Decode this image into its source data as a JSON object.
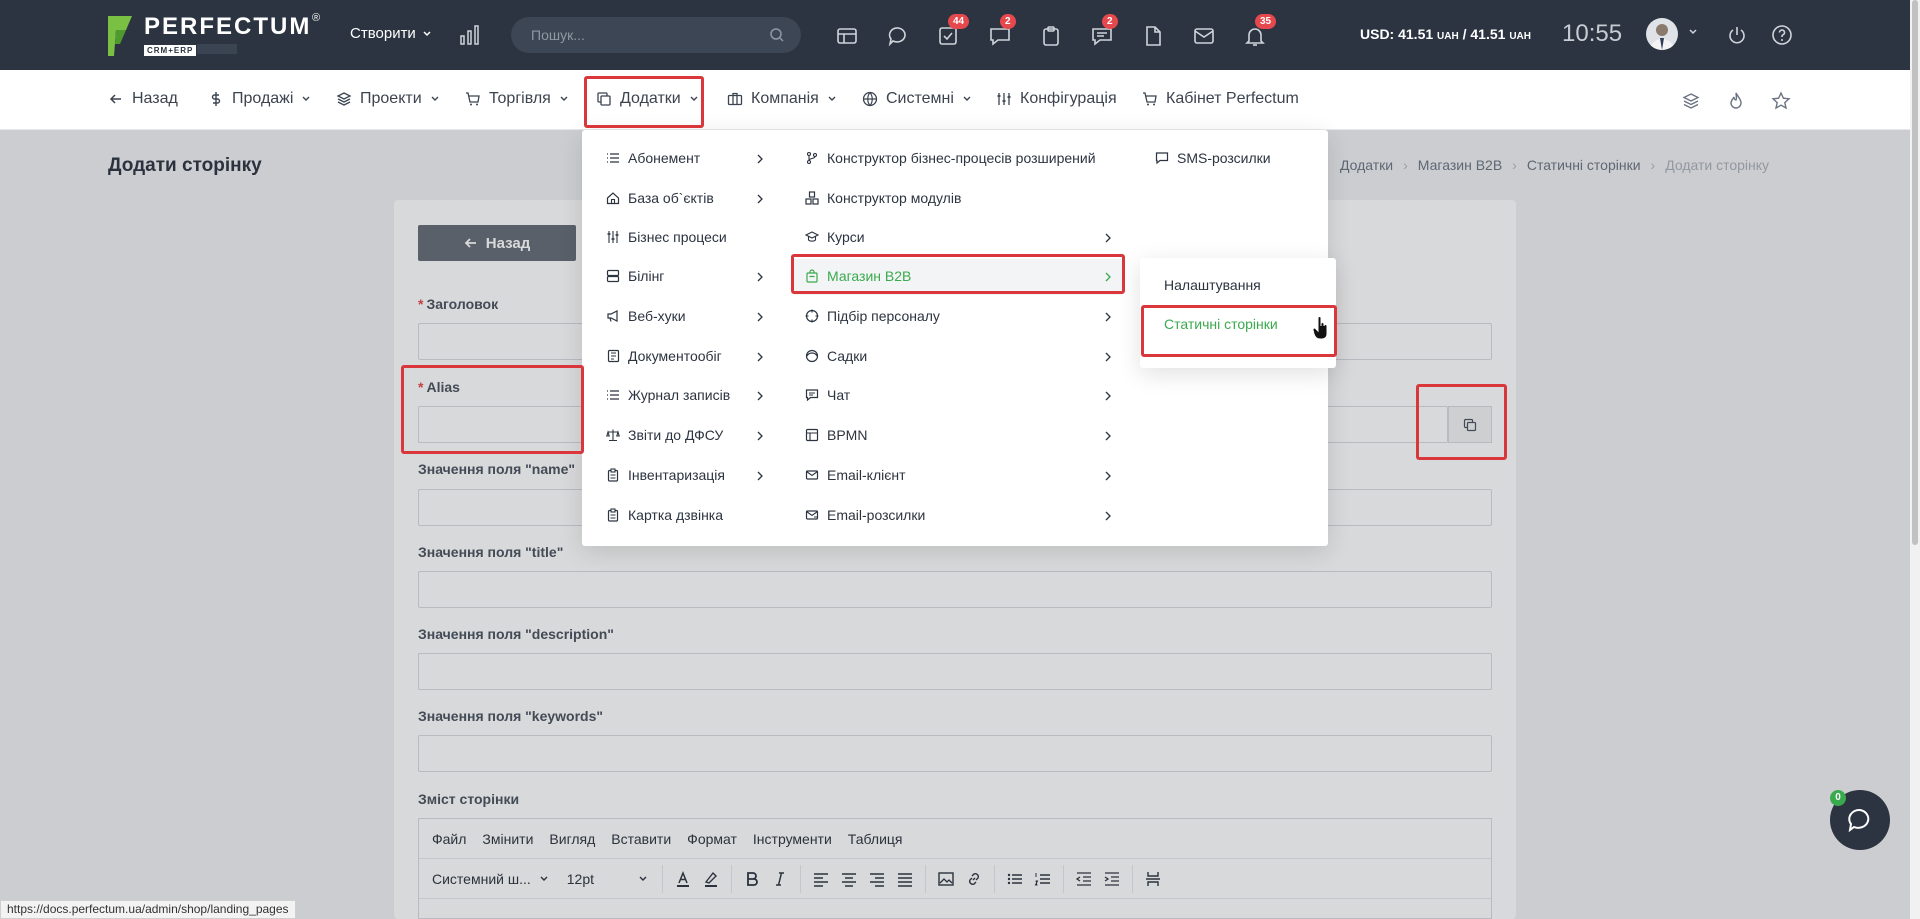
{
  "app": {
    "logo_word": "PERFECTUM",
    "logo_reg": "®",
    "logo_sub": "CRM+ERP"
  },
  "topbar": {
    "create_label": "Створити",
    "search_placeholder": "Пошук...",
    "badges": {
      "tasks": "44",
      "messages": "2",
      "comments": "2",
      "notifications": "35"
    },
    "currency": "USD: 41.51",
    "currency_unit_1": "UAH",
    "currency_mid": " / 41.51 ",
    "currency_unit_2": "UAH",
    "clock": "10:55"
  },
  "nav": {
    "back": "Назад",
    "sales": "Продажі",
    "projects": "Проекти",
    "trade": "Торгівля",
    "addons": "Додатки",
    "company": "Компанія",
    "system": "Системні",
    "config": "Конфігурація",
    "cabinet": "Кабінет Perfectum"
  },
  "page": {
    "title": "Додати сторінку",
    "breadcrumb": [
      "Додатки",
      "Магазин B2B",
      "Статичні сторінки",
      "Додати сторінку"
    ],
    "back_button": "Назад",
    "fields": {
      "heading": "Заголовок",
      "alias": "Alias",
      "name": "Значення поля \"name\"",
      "title": "Значення поля \"title\"",
      "description": "Значення поля \"description\"",
      "keywords": "Значення поля \"keywords\"",
      "content": "Зміст сторінки"
    },
    "required_mark": "*"
  },
  "editor": {
    "menu": [
      "Файл",
      "Змінити",
      "Вигляд",
      "Вставити",
      "Формат",
      "Інструменти",
      "Таблиця"
    ],
    "font": "Системний ш...",
    "size": "12pt"
  },
  "dropdown": {
    "col1": [
      "Абонемент",
      "База об`єктів",
      "Бізнес процеси",
      "Білінг",
      "Веб-хуки",
      "Документообіг",
      "Журнал записів",
      "Звіти до ДФСУ",
      "Інвентаризація",
      "Картка дзвінка"
    ],
    "col2": [
      "Конструктор бізнес-процесів розширений",
      "Конструктор модулів",
      "Курси",
      "Магазин B2B",
      "Підбір персоналу",
      "Садки",
      "Чат",
      "BPMN",
      "Email-клієнт",
      "Email-розсилки"
    ],
    "col3": [
      "SMS-розсилки"
    ],
    "submenu": [
      "Налаштування",
      "Статичні сторінки"
    ]
  },
  "chat": {
    "badge": "0"
  },
  "status_url": "https://docs.perfectum.ua/admin/shop/landing_pages",
  "colors": {
    "topbar": "#2b3440",
    "accent_green": "#3aaa4e",
    "highlight_red": "#d9373c",
    "badge_red": "#e5484d"
  }
}
